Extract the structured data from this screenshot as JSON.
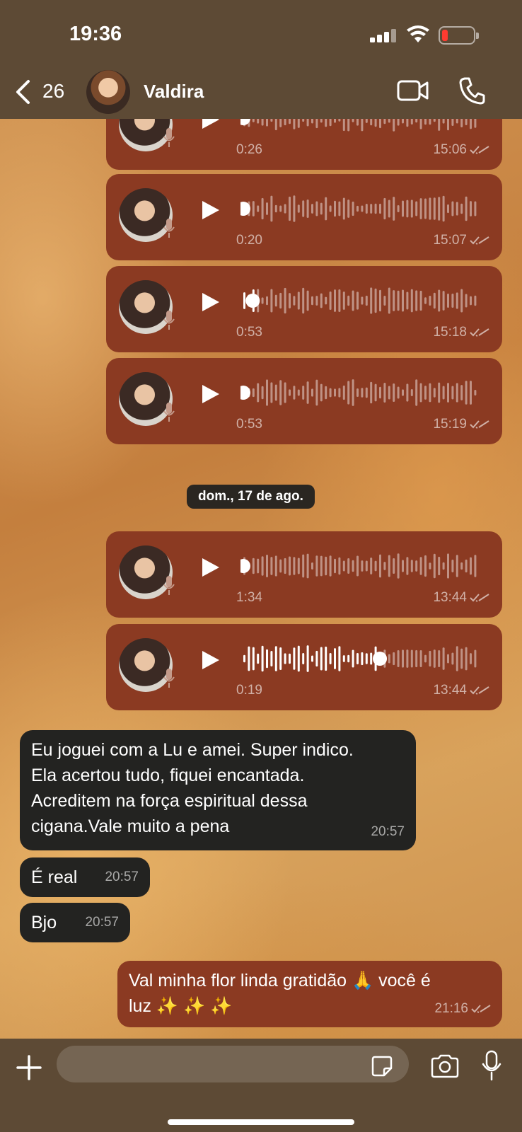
{
  "status_bar": {
    "time": "19:36"
  },
  "header": {
    "back_count": "26",
    "contact_name": "Valdira"
  },
  "voice_messages": [
    {
      "duration": "0:26",
      "time": "15:06",
      "progress": 0.0
    },
    {
      "duration": "0:20",
      "time": "15:07",
      "progress": 0.0
    },
    {
      "duration": "0:53",
      "time": "15:18",
      "progress": 0.04
    },
    {
      "duration": "0:53",
      "time": "15:19",
      "progress": 0.0
    },
    {
      "duration": "1:34",
      "time": "13:44",
      "progress": 0.0
    },
    {
      "duration": "0:19",
      "time": "13:44",
      "progress": 0.58
    }
  ],
  "date_separator": "dom., 17 de ago.",
  "incoming_messages": [
    {
      "lines": [
        "Eu joguei com a Lu e amei. Super indico.",
        "Ela acertou tudo, fiquei encantada.",
        "Acreditem na força espiritual dessa",
        "cigana.Vale muito a pena"
      ],
      "time": "20:57"
    },
    {
      "lines": [
        "É real"
      ],
      "time": "20:57"
    },
    {
      "lines": [
        "Bjo"
      ],
      "time": "20:57"
    }
  ],
  "outgoing_message": {
    "lines": [
      "Val minha flor linda gratidão 🙏 você é",
      "luz ✨ ✨ ✨"
    ],
    "time": "21:16"
  },
  "colors": {
    "header_bg": "#5d4a35",
    "outgoing_bubble": "#8b3a22",
    "incoming_bubble": "#232321"
  }
}
